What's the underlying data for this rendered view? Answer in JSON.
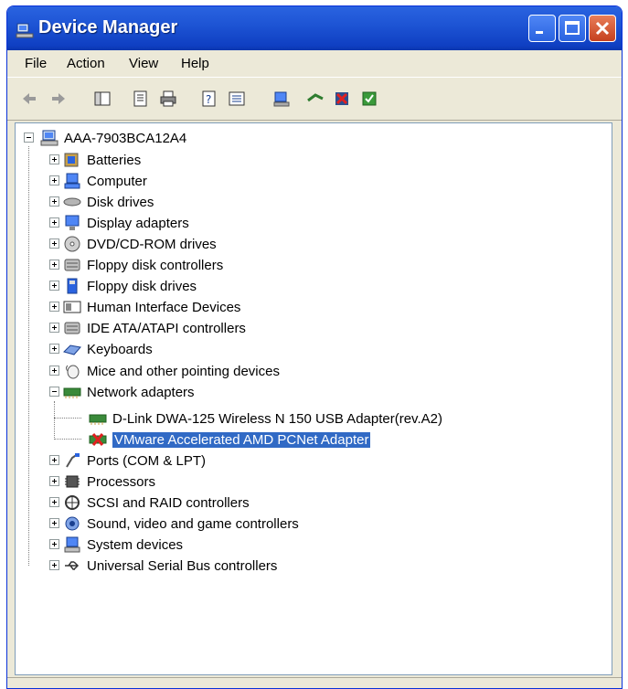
{
  "window": {
    "title": "Device Manager"
  },
  "menu": [
    "File",
    "Action",
    "View",
    "Help"
  ],
  "tree": {
    "root": "AAA-7903BCA12A4",
    "categories": [
      {
        "label": "Batteries",
        "icon": "battery-icon"
      },
      {
        "label": "Computer",
        "icon": "computer-icon"
      },
      {
        "label": "Disk drives",
        "icon": "disk-drive-icon"
      },
      {
        "label": "Display adapters",
        "icon": "display-adapter-icon"
      },
      {
        "label": "DVD/CD-ROM drives",
        "icon": "cd-drive-icon"
      },
      {
        "label": "Floppy disk controllers",
        "icon": "floppy-controller-icon"
      },
      {
        "label": "Floppy disk drives",
        "icon": "floppy-drive-icon"
      },
      {
        "label": "Human Interface Devices",
        "icon": "hid-icon"
      },
      {
        "label": "IDE ATA/ATAPI controllers",
        "icon": "ide-controller-icon"
      },
      {
        "label": "Keyboards",
        "icon": "keyboard-icon"
      },
      {
        "label": "Mice and other pointing devices",
        "icon": "mouse-icon"
      },
      {
        "label": "Network adapters",
        "icon": "network-adapter-icon",
        "expanded": true,
        "children": [
          {
            "label": "D-Link DWA-125 Wireless N 150 USB Adapter(rev.A2)",
            "icon": "network-card-icon"
          },
          {
            "label": "VMware Accelerated AMD PCNet Adapter",
            "icon": "network-card-disabled-icon",
            "selected": true
          }
        ]
      },
      {
        "label": "Ports (COM & LPT)",
        "icon": "port-icon"
      },
      {
        "label": "Processors",
        "icon": "processor-icon"
      },
      {
        "label": "SCSI and RAID controllers",
        "icon": "scsi-icon"
      },
      {
        "label": "Sound, video and game controllers",
        "icon": "sound-icon"
      },
      {
        "label": "System devices",
        "icon": "system-device-icon"
      },
      {
        "label": "Universal Serial Bus controllers",
        "icon": "usb-icon"
      }
    ]
  },
  "colors": {
    "selection": "#316ac5",
    "titlebar": "#1e55d5"
  }
}
